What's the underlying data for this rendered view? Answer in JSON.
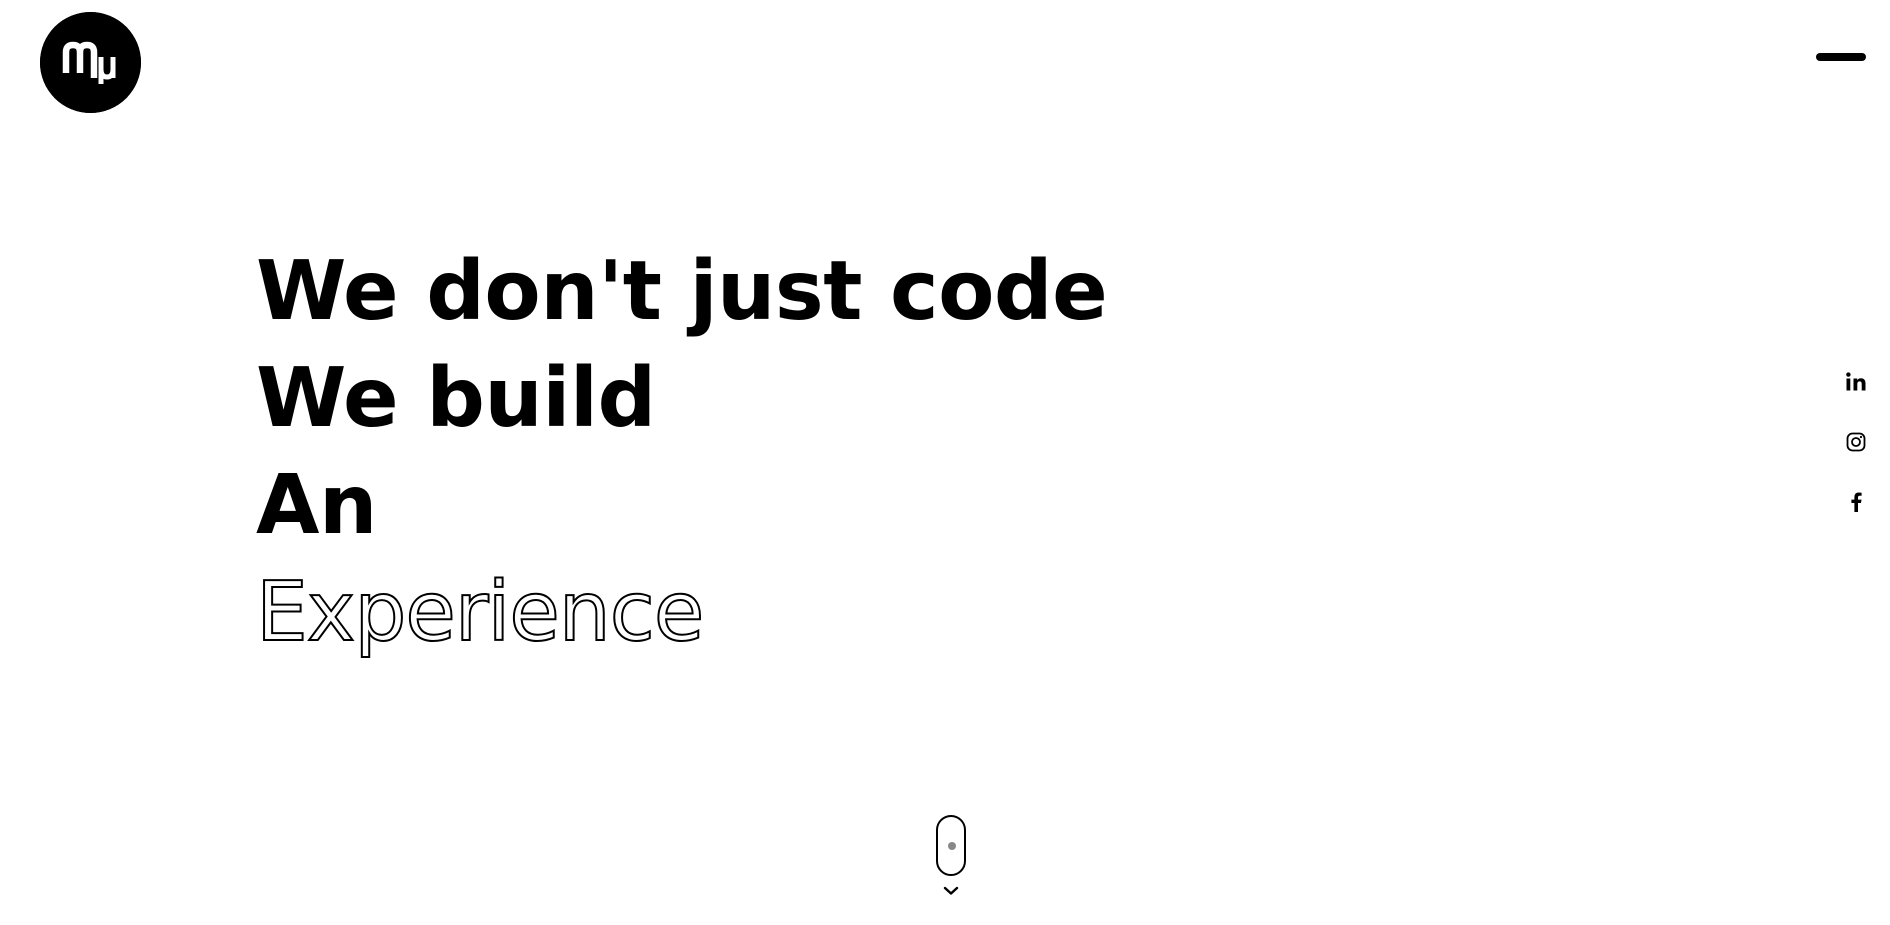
{
  "header": {
    "logo_icon": "mu-logo-icon",
    "menu_icon": "hamburger-menu-icon"
  },
  "hero": {
    "lines": [
      "We don't just code",
      "We build",
      "An",
      "Experience"
    ]
  },
  "social": {
    "items": [
      {
        "icon": "linkedin-icon"
      },
      {
        "icon": "instagram-icon"
      },
      {
        "icon": "facebook-icon"
      }
    ]
  },
  "scroll": {
    "icon": "scroll-mouse-icon",
    "arrow_icon": "chevron-down-icon"
  },
  "colors": {
    "background": "#ffffff",
    "foreground": "#000000",
    "wheel": "#888888"
  }
}
